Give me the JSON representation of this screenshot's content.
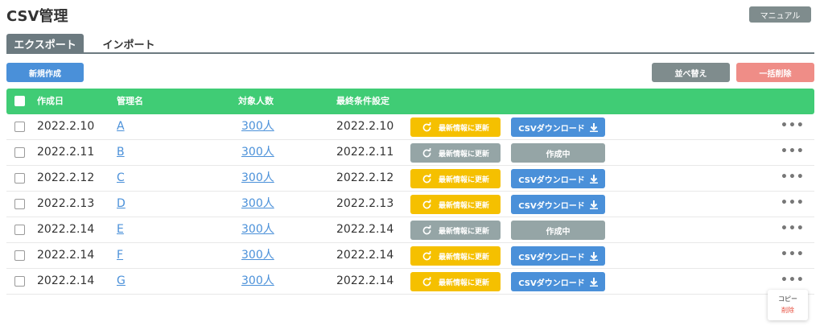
{
  "page": {
    "title": "CSV管理",
    "manual_label": "マニュアル"
  },
  "tabs": [
    {
      "label": "エクスポート",
      "active": true
    },
    {
      "label": "インポート",
      "active": false
    }
  ],
  "toolbar": {
    "new_label": "新規作成",
    "sort_label": "並べ替え",
    "bulk_delete_label": "一括削除"
  },
  "table": {
    "headers": {
      "created": "作成日",
      "name": "管理名",
      "count": "対象人数",
      "last_condition": "最終条件設定"
    },
    "rows": [
      {
        "created": "2022.2.10",
        "name": "A",
        "count": "300人",
        "last": "2022.2.10",
        "update_label": "最新情報に更新",
        "update_state": "active",
        "download_label": "CSVダウンロード",
        "download_state": "ready"
      },
      {
        "created": "2022.2.11",
        "name": "B",
        "count": "300人",
        "last": "2022.2.11",
        "update_label": "最新情報に更新",
        "update_state": "disabled",
        "download_label": "作成中",
        "download_state": "processing"
      },
      {
        "created": "2022.2.12",
        "name": "C",
        "count": "300人",
        "last": "2022.2.12",
        "update_label": "最新情報に更新",
        "update_state": "active",
        "download_label": "CSVダウンロード",
        "download_state": "ready"
      },
      {
        "created": "2022.2.13",
        "name": "D",
        "count": "300人",
        "last": "2022.2.13",
        "update_label": "最新情報に更新",
        "update_state": "active",
        "download_label": "CSVダウンロード",
        "download_state": "ready"
      },
      {
        "created": "2022.2.14",
        "name": "E",
        "count": "300人",
        "last": "2022.2.14",
        "update_label": "最新情報に更新",
        "update_state": "disabled",
        "download_label": "作成中",
        "download_state": "processing"
      },
      {
        "created": "2022.2.14",
        "name": "F",
        "count": "300人",
        "last": "2022.2.14",
        "update_label": "最新情報に更新",
        "update_state": "active",
        "download_label": "CSVダウンロード",
        "download_state": "ready"
      },
      {
        "created": "2022.2.14",
        "name": "G",
        "count": "300人",
        "last": "2022.2.14",
        "update_label": "最新情報に更新",
        "update_state": "active",
        "download_label": "CSVダウンロード",
        "download_state": "ready"
      }
    ]
  },
  "context_menu": {
    "copy_label": "コピー",
    "delete_label": "削除"
  },
  "icons": {
    "update": "refresh-icon",
    "download": "download-icon",
    "more": "more-icon"
  },
  "colors": {
    "header_green": "#40cc75",
    "update_yellow": "#f5c000",
    "download_blue": "#4a90d9",
    "disabled_gray": "#95a5a6",
    "delete_red": "#ef8d87",
    "link_blue": "#4a90d9"
  }
}
